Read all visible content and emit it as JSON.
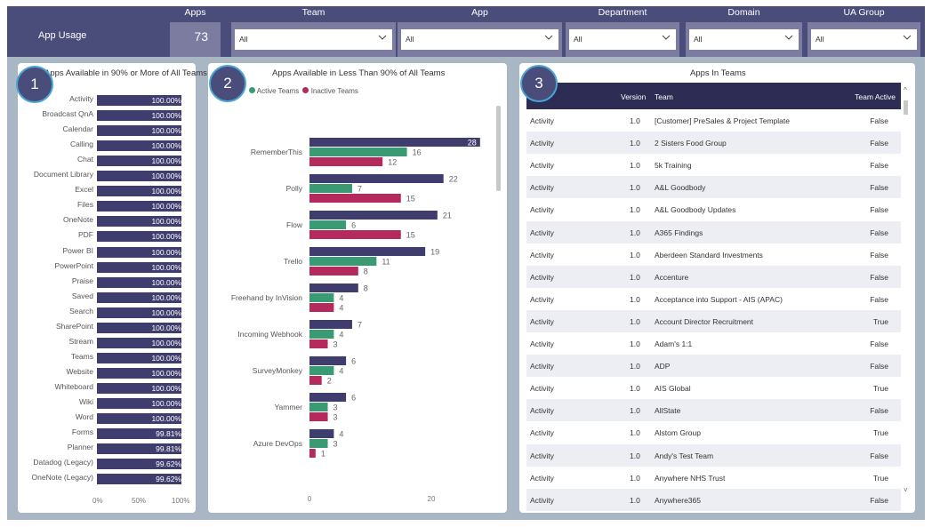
{
  "header": {
    "title": "App Usage",
    "apps_label": "Apps",
    "apps_count": "73",
    "filters": [
      {
        "label": "Team",
        "value": "All"
      },
      {
        "label": "App",
        "value": "All"
      },
      {
        "label": "Department",
        "value": "All"
      },
      {
        "label": "Domain",
        "value": "All"
      },
      {
        "label": "UA Group",
        "value": "All"
      }
    ]
  },
  "cards": {
    "c1": {
      "badge": "1",
      "title": "Apps Available in 90% or More of All Teams"
    },
    "c2": {
      "badge": "2",
      "title": "Apps Available in Less Than 90% of All Teams"
    },
    "c3": {
      "badge": "3",
      "title": "Apps In Teams"
    }
  },
  "colors": {
    "navy": "#3f3d6e",
    "green": "#3a9a74",
    "crimson": "#b42a5c",
    "header": "#4a4c7a"
  },
  "chart_data": [
    {
      "type": "bar",
      "orientation": "horizontal",
      "title": "Apps Available in 90% or More of All Teams",
      "categories": [
        "Activity",
        "Broadcast QnA",
        "Calendar",
        "Calling",
        "Chat",
        "Document Library",
        "Excel",
        "Files",
        "OneNote",
        "PDF",
        "Power BI",
        "PowerPoint",
        "Praise",
        "Saved",
        "Search",
        "SharePoint",
        "Stream",
        "Teams",
        "Website",
        "Whiteboard",
        "Wiki",
        "Word",
        "Forms",
        "Planner",
        "Datadog (Legacy)",
        "OneNote (Legacy)"
      ],
      "values": [
        100,
        100,
        100,
        100,
        100,
        100,
        100,
        100,
        100,
        100,
        100,
        100,
        100,
        100,
        100,
        100,
        100,
        100,
        100,
        100,
        100,
        100,
        99.81,
        99.81,
        99.62,
        99.62
      ],
      "labels": [
        "100.00%",
        "100.00%",
        "100.00%",
        "100.00%",
        "100.00%",
        "100.00%",
        "100.00%",
        "100.00%",
        "100.00%",
        "100.00%",
        "100.00%",
        "100.00%",
        "100.00%",
        "100.00%",
        "100.00%",
        "100.00%",
        "100.00%",
        "100.00%",
        "100.00%",
        "100.00%",
        "100.00%",
        "100.00%",
        "99.81%",
        "99.81%",
        "99.62%",
        "99.62%"
      ],
      "xticks": [
        "0%",
        "50%",
        "100%"
      ],
      "xlim": [
        0,
        100
      ]
    },
    {
      "type": "bar",
      "orientation": "horizontal",
      "title": "Apps Available in Less Than 90% of All Teams",
      "legend": [
        "Active Teams",
        "Inactive Teams"
      ],
      "legend_position": "top-left",
      "categories": [
        "RememberThis",
        "Polly",
        "Flow",
        "Trello",
        "Freehand by InVision",
        "Incoming Webhook",
        "SurveyMonkey",
        "Yammer",
        "Azure DevOps"
      ],
      "series": [
        {
          "values": [
            28,
            22,
            21,
            19,
            8,
            7,
            6,
            6,
            4
          ]
        },
        {
          "name": "Active Teams",
          "values": [
            16,
            7,
            6,
            11,
            4,
            4,
            4,
            3,
            3
          ]
        },
        {
          "name": "Inactive Teams",
          "values": [
            12,
            15,
            15,
            8,
            4,
            3,
            2,
            3,
            1
          ]
        }
      ],
      "xticks": [
        "0",
        "20"
      ],
      "xlim": [
        0,
        28
      ]
    }
  ],
  "table": {
    "columns": [
      "",
      "Version",
      "Team",
      "Team Active"
    ],
    "rows": [
      [
        "Activity",
        "1.0",
        "[Customer] PreSales & Project Template",
        "False"
      ],
      [
        "Activity",
        "1.0",
        "2 Sisters Food Group",
        "False"
      ],
      [
        "Activity",
        "1.0",
        "5k Training",
        "False"
      ],
      [
        "Activity",
        "1.0",
        "A&L Goodbody",
        "False"
      ],
      [
        "Activity",
        "1.0",
        "A&L Goodbody Updates",
        "False"
      ],
      [
        "Activity",
        "1.0",
        "A365 Findings",
        "False"
      ],
      [
        "Activity",
        "1.0",
        "Aberdeen Standard Investments",
        "False"
      ],
      [
        "Activity",
        "1.0",
        "Accenture",
        "False"
      ],
      [
        "Activity",
        "1.0",
        "Acceptance into Support - AIS (APAC)",
        "False"
      ],
      [
        "Activity",
        "1.0",
        "Account Director Recruitment",
        "True"
      ],
      [
        "Activity",
        "1.0",
        "Adam's 1:1",
        "False"
      ],
      [
        "Activity",
        "1.0",
        "ADP",
        "False"
      ],
      [
        "Activity",
        "1.0",
        "AIS Global",
        "True"
      ],
      [
        "Activity",
        "1.0",
        "AllState",
        "False"
      ],
      [
        "Activity",
        "1.0",
        "Alstom Group",
        "True"
      ],
      [
        "Activity",
        "1.0",
        "Andy's Test Team",
        "False"
      ],
      [
        "Activity",
        "1.0",
        "Anywhere NHS Trust",
        "True"
      ],
      [
        "Activity",
        "1.0",
        "Anywhere365",
        "False"
      ]
    ]
  }
}
